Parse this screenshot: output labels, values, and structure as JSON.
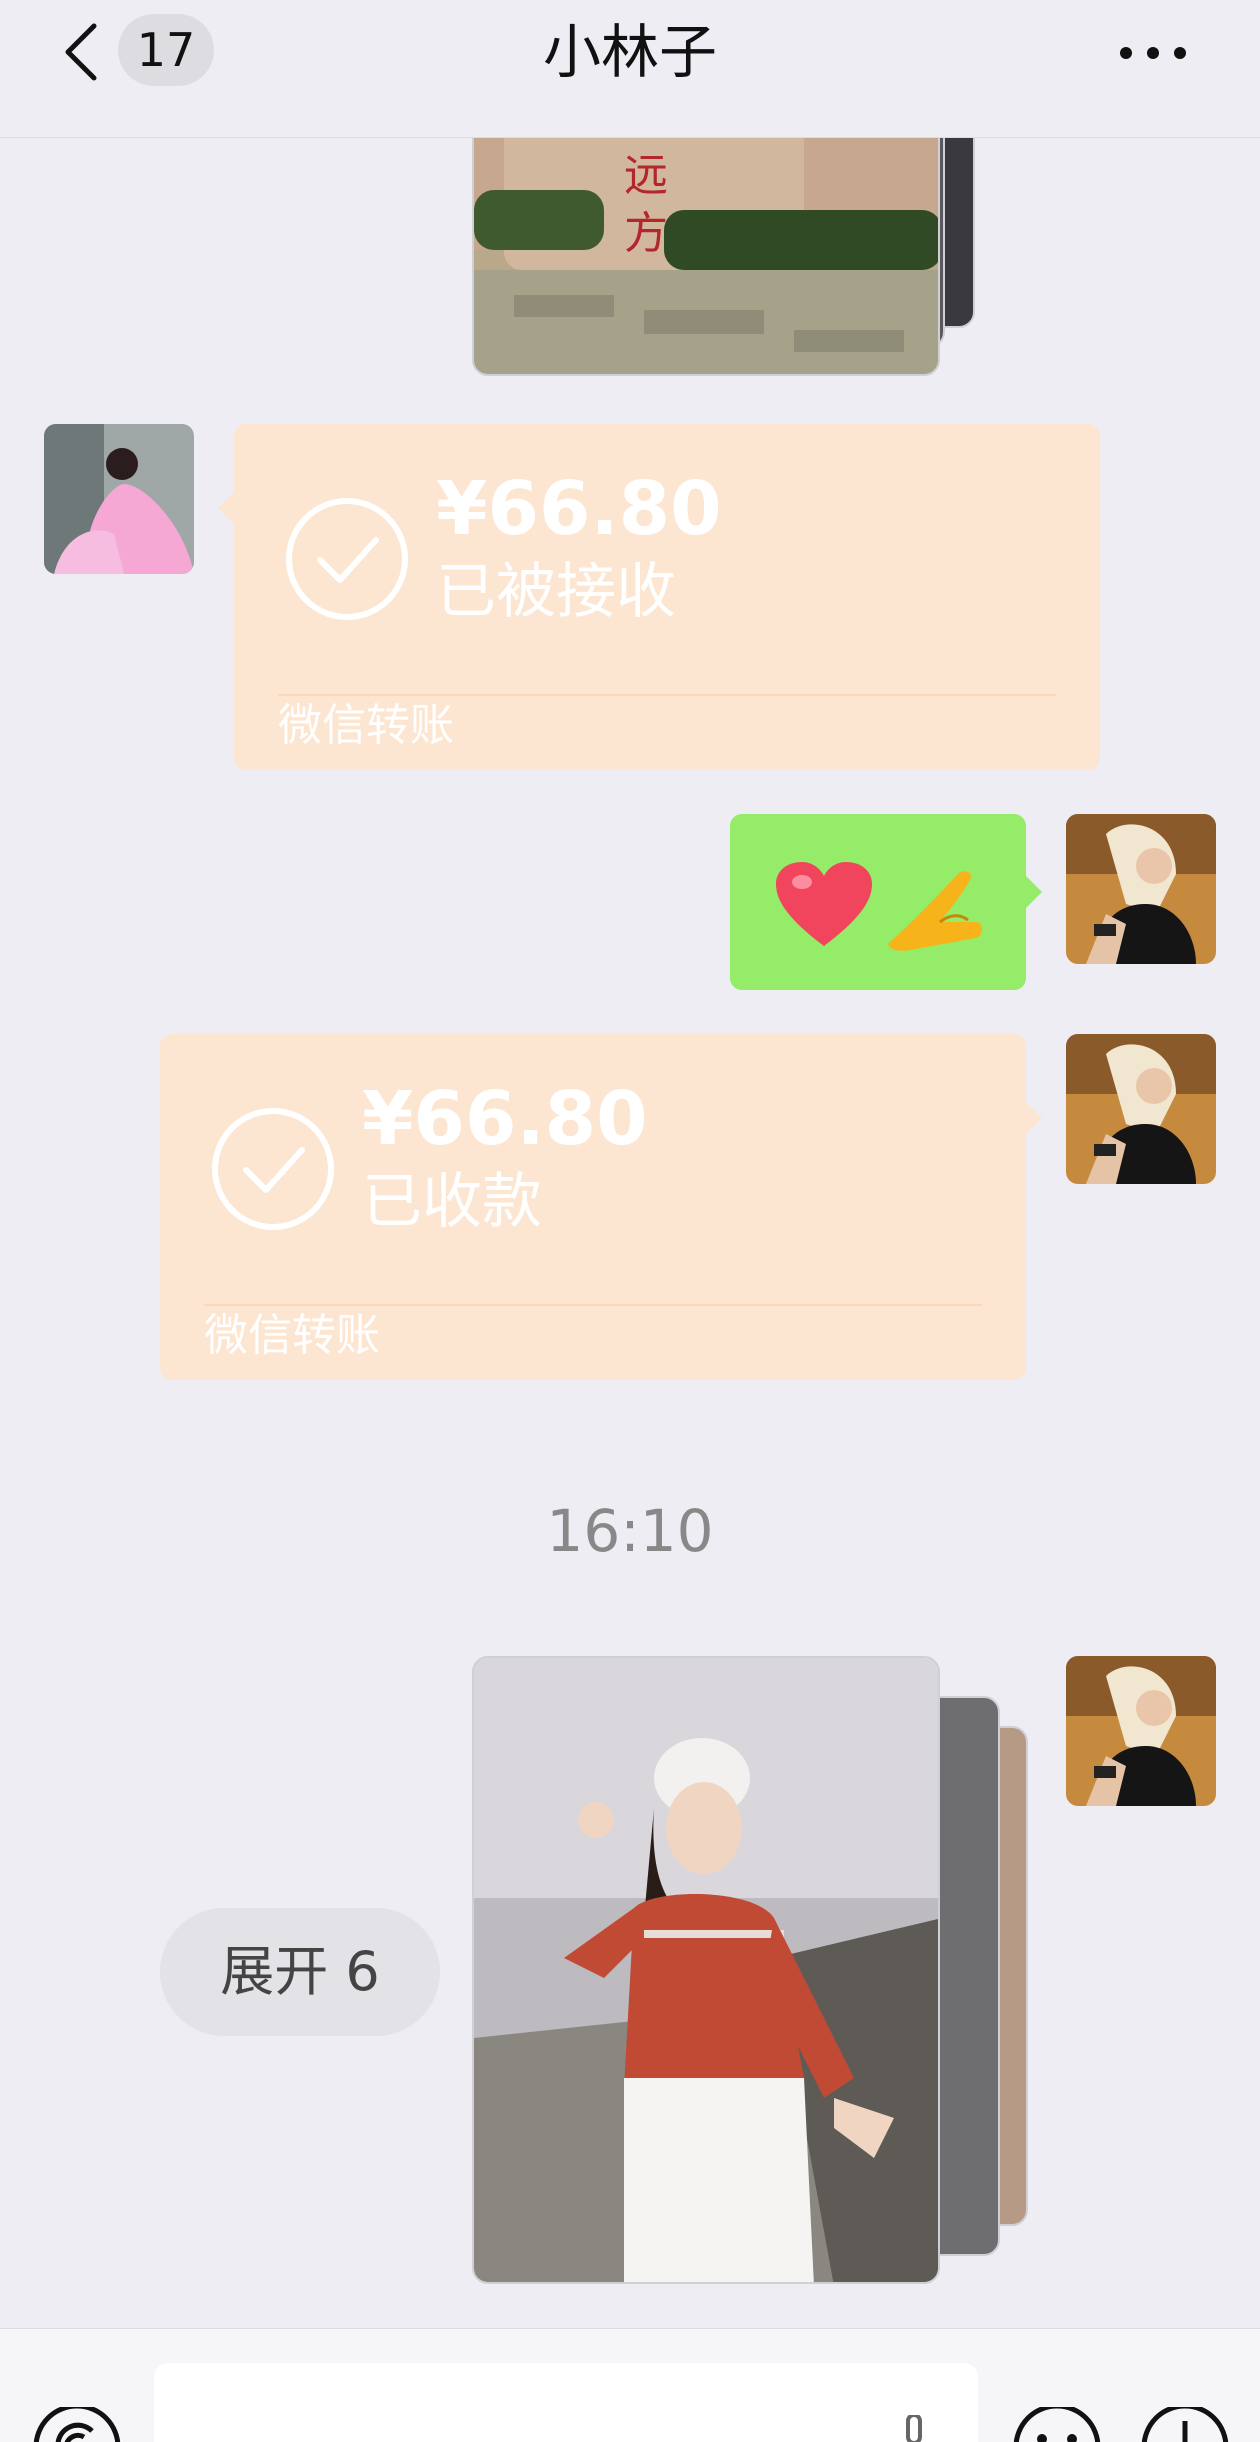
{
  "header": {
    "unread_count": "17",
    "title": "小林子"
  },
  "messages": {
    "received_transfer": {
      "amount": "¥66.80",
      "status": "已被接收",
      "footer": "微信转账"
    },
    "sent_emoji": "❤️🤌",
    "sent_transfer": {
      "amount": "¥66.80",
      "status": "已收款",
      "footer": "微信转账"
    },
    "timestamp": "16:10",
    "expand_label": "展开 6"
  },
  "colors": {
    "background": "#EDEDF3",
    "transfer_bubble": "#FCE6D1",
    "sent_bubble": "#95EC69"
  },
  "icons": [
    "back-icon",
    "more-icon",
    "check-circle-icon",
    "voice-icon",
    "emoji-icon",
    "add-icon"
  ]
}
